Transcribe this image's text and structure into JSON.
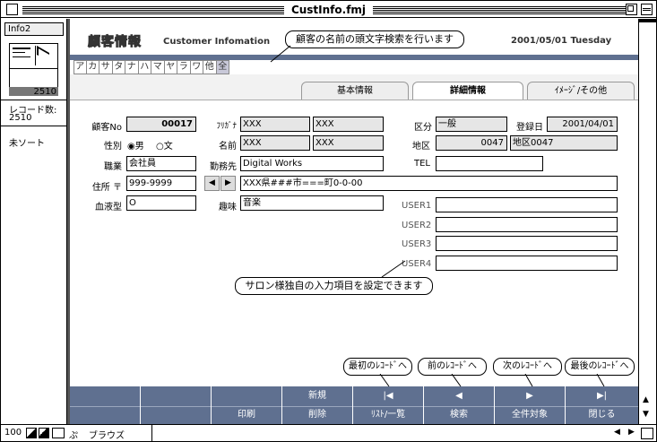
{
  "window": {
    "title": "CustInfo.fmj"
  },
  "left_panel": {
    "layout_name": "Info2",
    "record_number": "2510",
    "record_count_label": "レコード数:",
    "record_count": "2510",
    "sort_status": "未ソート"
  },
  "header": {
    "title_jp": "顧客情報",
    "title_en": "Customer Infomation",
    "date": "2001/05/01 Tuesday"
  },
  "kana_index": [
    "ア",
    "カ",
    "サ",
    "タ",
    "ナ",
    "ハ",
    "マ",
    "ヤ",
    "ラ",
    "ワ",
    "他",
    "全"
  ],
  "tabs": [
    {
      "label": "基本情報"
    },
    {
      "label": "詳細情報"
    },
    {
      "label": "ｲﾒｰｼﾞ/その他"
    }
  ],
  "form": {
    "customer_no_label": "顧客No",
    "customer_no": "00017",
    "furigana_label": "ﾌﾘｶﾞﾅ",
    "furigana_last": "XXX",
    "furigana_first": "XXX",
    "category_label": "区分",
    "category": "一般",
    "registered_label": "登録日",
    "registered": "2001/04/01",
    "gender_label": "性別",
    "gender_male": "男",
    "gender_female": "文",
    "name_label": "名前",
    "name_last": "XXX",
    "name_first": "XXX",
    "region_label": "地区",
    "region_code": "0047",
    "region_name": "地区0047",
    "occupation_label": "職業",
    "occupation": "会社員",
    "workplace_label": "勤務先",
    "workplace": "Digital Works",
    "tel_label": "TEL",
    "tel": "",
    "address_label": "住所 〒",
    "zip": "999-9999",
    "address": "XXX県###市===町0-0-00",
    "blood_label": "血液型",
    "blood": "O",
    "hobby_label": "趣味",
    "hobby": "音楽",
    "user1_label": "USER1",
    "user2_label": "USER2",
    "user3_label": "USER3",
    "user4_label": "USER4",
    "user1": "",
    "user2": "",
    "user3": "",
    "user4": ""
  },
  "callouts": {
    "search": "顧客の名前の頭文字検索を行います",
    "user_fields": "サロン様独自の入力項目を設定できます",
    "first": "最初のﾚｺｰﾄﾞへ",
    "prev": "前のﾚｺｰﾄﾞへ",
    "next": "次のﾚｺｰﾄﾞへ",
    "last": "最後のﾚｺｰﾄﾞへ"
  },
  "nav_buttons": [
    {
      "top": "",
      "bottom": ""
    },
    {
      "top": "",
      "bottom": ""
    },
    {
      "top": "",
      "bottom": "印刷"
    },
    {
      "top": "新規",
      "bottom": "削除"
    },
    {
      "top": "|◀",
      "bottom": "ﾘｽﾄ/一覧"
    },
    {
      "top": "◀",
      "bottom": "検索"
    },
    {
      "top": "▶",
      "bottom": "全件対象"
    },
    {
      "top": "▶|",
      "bottom": "閉じる"
    }
  ],
  "status_bar": {
    "zoom": "100",
    "mode": "ブラウズ"
  },
  "colors": {
    "nav_bg": "#5f7090",
    "field_gray": "#e6e6e6"
  }
}
